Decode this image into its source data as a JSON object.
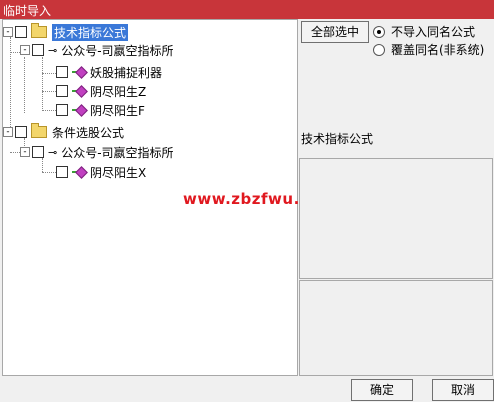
{
  "window": {
    "title": "临时导入"
  },
  "tree": {
    "nodes": [
      {
        "label": "技术指标公式",
        "expander": "-"
      },
      {
        "label": "公众号-司嬴空指标所",
        "expander": "-"
      },
      {
        "label": "妖股捕捉利器"
      },
      {
        "label": "阴尽阳生Z"
      },
      {
        "label": "阴尽阳生F"
      },
      {
        "label": "条件选股公式",
        "expander": "-"
      },
      {
        "label": "公众号-司嬴空指标所",
        "expander": "-"
      },
      {
        "label": "阴尽阳生X"
      }
    ]
  },
  "options": {
    "select_all": "全部选中",
    "radio_no_import": "不导入同名公式",
    "radio_overwrite": "覆盖同名(非系统)",
    "selected": "radio_no_import"
  },
  "info": {
    "heading": "技术指标公式"
  },
  "watermark": "www.zbzfwu.com",
  "footer": {
    "ok": "确定",
    "cancel": "取消"
  }
}
